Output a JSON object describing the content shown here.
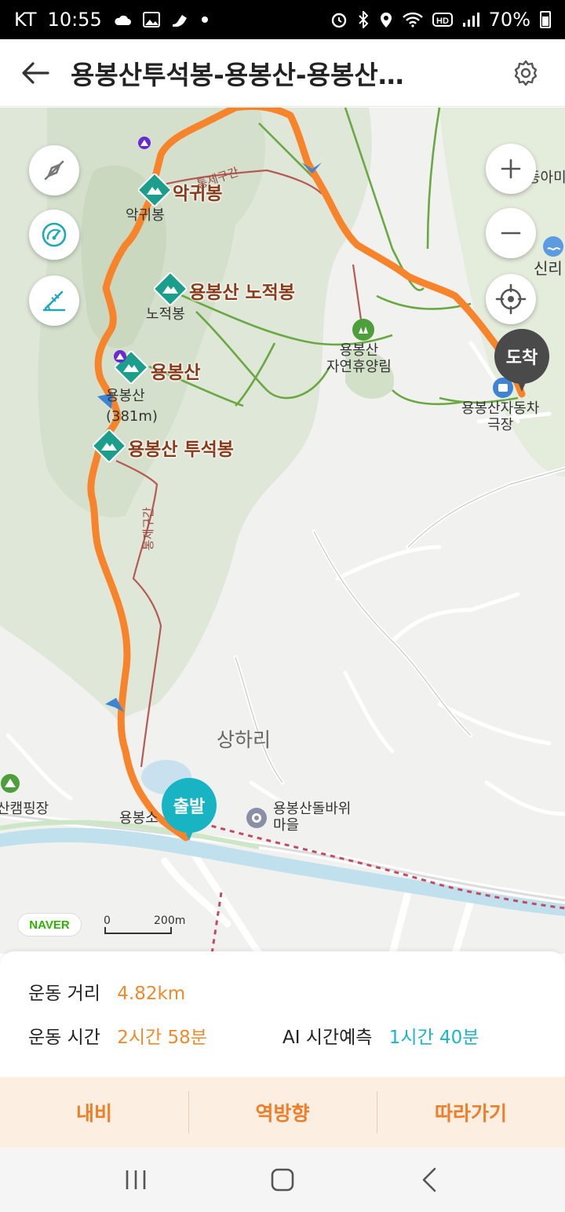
{
  "status_bar": {
    "carrier": "KT",
    "time": "10:55",
    "battery": "70%",
    "icons_left": [
      "cloud-icon",
      "image-icon",
      "shoe-icon",
      "dot-icon"
    ],
    "icons_right": [
      "alarm-icon",
      "bluetooth-icon",
      "location-icon",
      "wifi-icon",
      "hd-icon",
      "signal-icon",
      "battery-icon"
    ]
  },
  "header": {
    "title": "용봉산투석봉-용봉산-용봉산…"
  },
  "map": {
    "peaks": {
      "akgwibong": "악귀봉",
      "nojeokbong": "용봉산 노적봉",
      "yongbongsan": "용봉산",
      "tuseokbong": "용봉산 투석봉"
    },
    "labels": {
      "akgwibong_small": "악귀봉",
      "nojeokbong_small": "노적봉",
      "yongbongsan_small": "용봉산",
      "altitude": "(381m)",
      "forest": "용봉산\n자연휴양림",
      "theater": "용봉산자동차\n극장",
      "village": "상하리",
      "camping": "산캠핑장",
      "dolbawi": "용봉산돌바위\n마을",
      "yongbongso": "용봉소",
      "sinri": "신리",
      "ama": "등아미",
      "restricted_1": "통제구간",
      "restricted_2": "통제구간"
    },
    "pins": {
      "start": "출발",
      "arrive": "도착"
    },
    "naver_logo": "NAVER",
    "scale_zero": "0",
    "scale_distance": "200m",
    "colors": {
      "route": "#f7842b",
      "start_pin": "#19b4c4",
      "arrive_pin": "#4a4a4a",
      "forest": "#dde6d6",
      "trail": "#6aa843",
      "restricted": "#b55a52"
    }
  },
  "stats": {
    "distance_label": "운동 거리",
    "distance_value": "4.82km",
    "time_label": "운동 시간",
    "time_value": "2시간 58분",
    "ai_label": "AI 시간예측",
    "ai_value": "1시간 40분"
  },
  "actions": {
    "navigate": "내비",
    "reverse": "역방향",
    "follow": "따라가기"
  }
}
